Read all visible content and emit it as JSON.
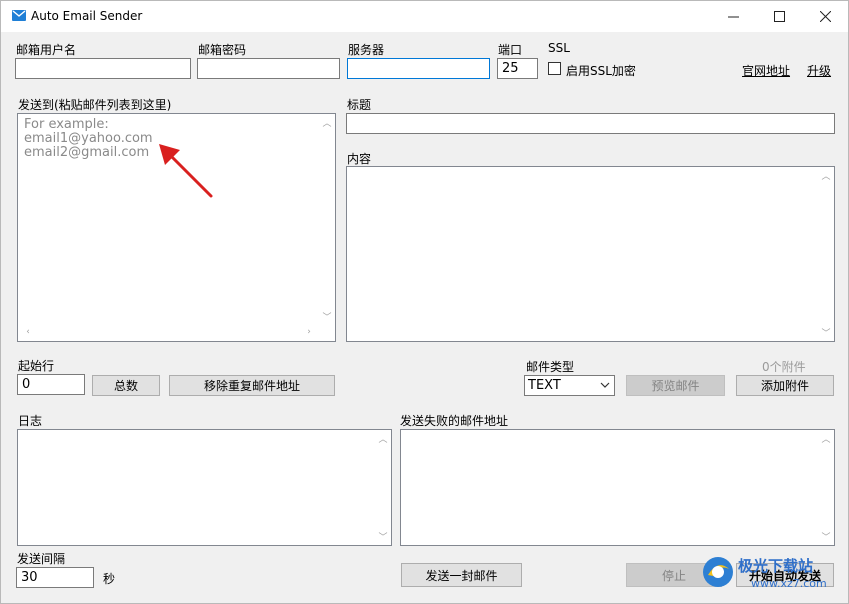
{
  "window": {
    "title": "Auto Email Sender",
    "controls": {
      "minimize": "─",
      "maximize": "☐",
      "close": "✕"
    }
  },
  "account": {
    "username_label": "邮箱用户名",
    "username_value": "",
    "password_label": "邮箱密码",
    "password_value": "",
    "server_label": "服务器",
    "server_value": "",
    "port_label": "端口",
    "port_value": "25",
    "ssl_label": "SSL",
    "ssl_checkbox_label": "启用SSL加密",
    "ssl_checked": false
  },
  "links": {
    "website": "官网地址",
    "upgrade": "升级"
  },
  "recipients": {
    "label": "发送到(粘贴邮件列表到这里)",
    "placeholder_lines": [
      "For example:",
      "email1@yahoo.com",
      "email2@gmail.com"
    ]
  },
  "subject": {
    "label": "标题",
    "value": ""
  },
  "content": {
    "label": "内容",
    "value": ""
  },
  "start_row": {
    "label": "起始行",
    "value": "0"
  },
  "buttons": {
    "total": "总数",
    "remove_duplicates": "移除重复邮件地址",
    "preview": "预览邮件",
    "add_attachment": "添加附件",
    "send_one": "发送一封邮件",
    "stop": "停止",
    "start_auto_send": "开始自动发送"
  },
  "mail_type": {
    "label": "邮件类型",
    "selected": "TEXT"
  },
  "attachments": {
    "count_label": "0个附件"
  },
  "log": {
    "label": "日志"
  },
  "failed": {
    "label": "发送失败的邮件地址"
  },
  "interval": {
    "label": "发送间隔",
    "value": "30",
    "unit": "秒"
  },
  "watermark": {
    "text": "极光下载站",
    "url": "www.xz7.com"
  },
  "colors": {
    "annotation_arrow": "#d9201f",
    "focus_border": "#0078d7"
  },
  "icons": {
    "app": "envelope-icon"
  }
}
